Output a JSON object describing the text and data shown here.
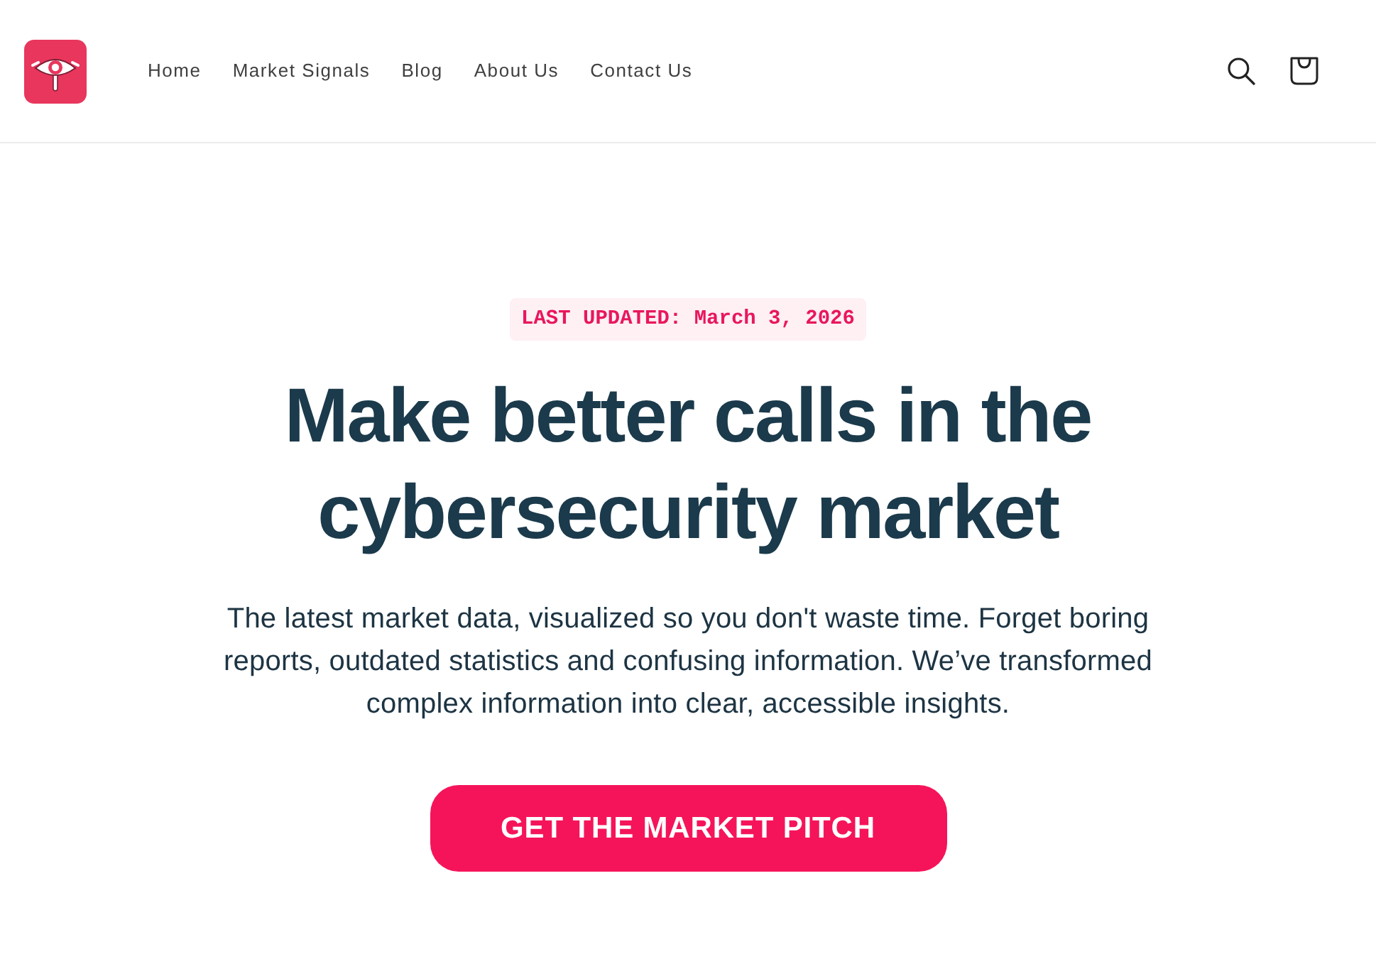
{
  "header": {
    "nav_links": [
      "Home",
      "Market Signals",
      "Blog",
      "About Us",
      "Contact Us"
    ]
  },
  "hero": {
    "badge": "LAST UPDATED: March 3, 2026",
    "heading": "Make better calls in the cybersecurity market",
    "description": "The latest market data, visualized so you don't waste time. Forget boring reports, outdated statistics and confusing information. We’ve transformed complex information into clear, accessible insights.",
    "button": "GET THE MARKET PITCH"
  }
}
